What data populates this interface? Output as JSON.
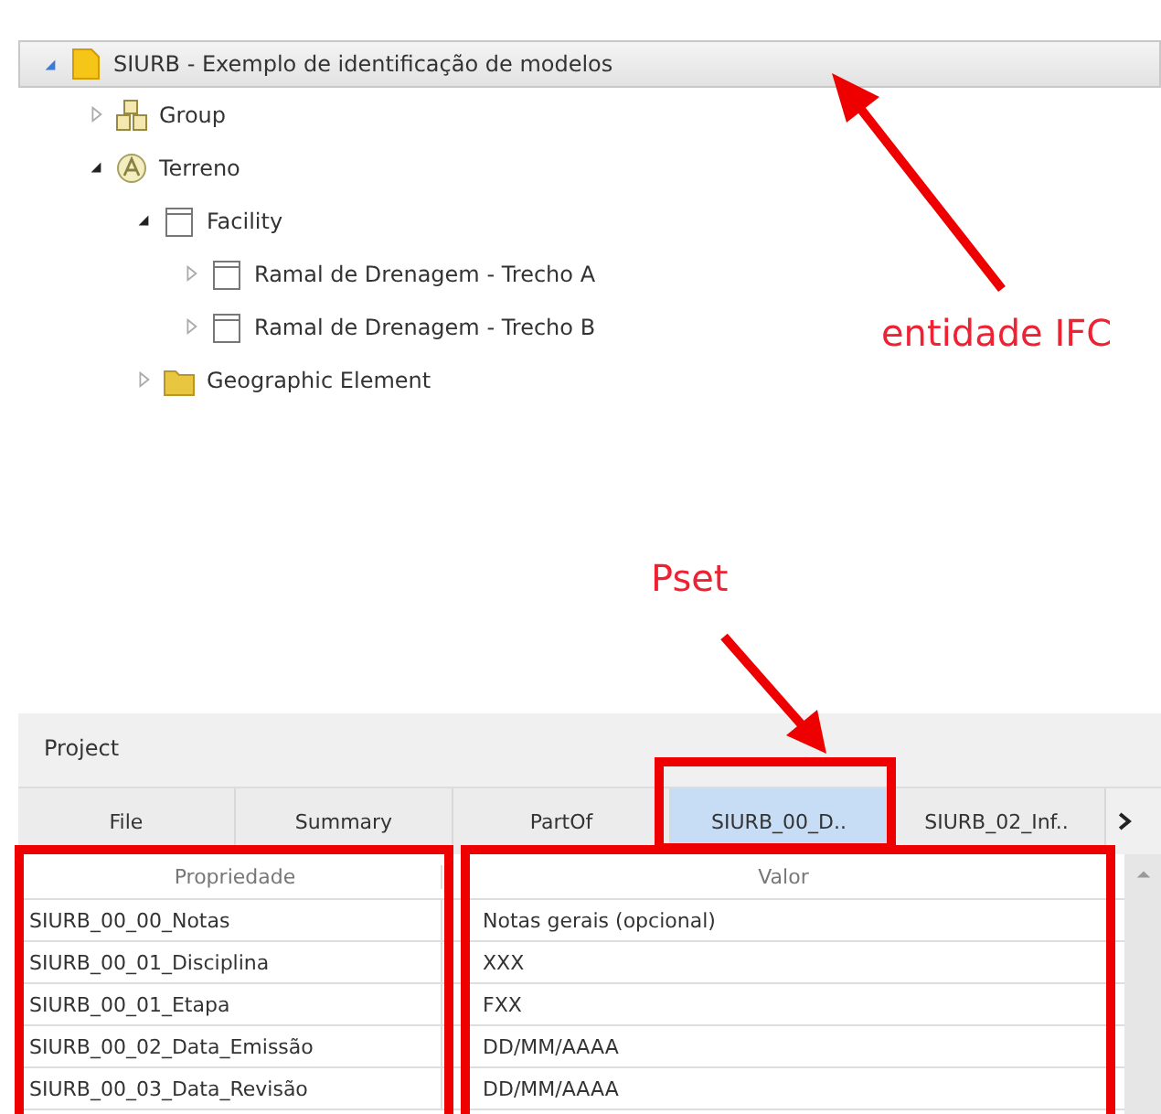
{
  "tree": [
    {
      "label": "SIURB - Exemplo de identificação de modelos",
      "kind": "document",
      "expanded": true,
      "selected": true,
      "children": [
        {
          "label": "Group",
          "kind": "group",
          "expanded": false,
          "selected": false
        },
        {
          "label": "Terreno",
          "kind": "site",
          "expanded": true,
          "selected": false,
          "children": [
            {
              "label": "Facility",
              "kind": "box",
              "expanded": true,
              "selected": false,
              "children": [
                {
                  "label": "Ramal de Drenagem - Trecho A",
                  "kind": "box",
                  "expanded": false,
                  "selected": false
                },
                {
                  "label": "Ramal de Drenagem - Trecho B",
                  "kind": "box",
                  "expanded": false,
                  "selected": false
                }
              ]
            },
            {
              "label": "Geographic Element",
              "kind": "folder",
              "expanded": false,
              "selected": false
            }
          ]
        }
      ]
    }
  ],
  "annotations": [
    {
      "text": "entidade IFC"
    },
    {
      "text": "Pset"
    }
  ],
  "panel": {
    "title": "Project",
    "tabs": [
      {
        "label": "File",
        "selected": false
      },
      {
        "label": "Summary",
        "selected": false
      },
      {
        "label": "PartOf",
        "selected": false
      },
      {
        "label": "SIURB_00_D..",
        "selected": true
      },
      {
        "label": "SIURB_02_Inf..",
        "selected": false
      }
    ],
    "columns": [
      "Propriedade",
      "Valor"
    ],
    "rows": [
      {
        "property": "SIURB_00_00_Notas",
        "value": "Notas gerais (opcional)"
      },
      {
        "property": "SIURB_00_01_Disciplina",
        "value": "XXX"
      },
      {
        "property": "SIURB_00_01_Etapa",
        "value": "FXX"
      },
      {
        "property": "SIURB_00_02_Data_Emissão",
        "value": "DD/MM/AAAA"
      },
      {
        "property": "SIURB_00_03_Data_Revisão",
        "value": "DD/MM/AAAA"
      }
    ]
  }
}
